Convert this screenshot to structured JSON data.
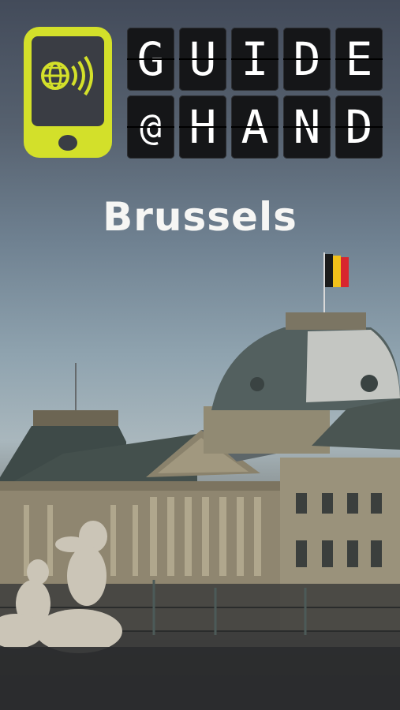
{
  "app": {
    "logo_row1": [
      "G",
      "U",
      "I",
      "D",
      "E"
    ],
    "logo_row2": [
      "@",
      "H",
      "A",
      "N",
      "D"
    ],
    "city_title": "Brussels"
  },
  "colors": {
    "brand_yellow": "#d3e02a",
    "tile_bg": "#151618",
    "flag_black": "#1b1b1b",
    "flag_yellow": "#f2c11a",
    "flag_red": "#d8262e"
  },
  "icons": [
    "phone-logo-icon",
    "globe-sound-icon",
    "belgian-flag-icon"
  ]
}
